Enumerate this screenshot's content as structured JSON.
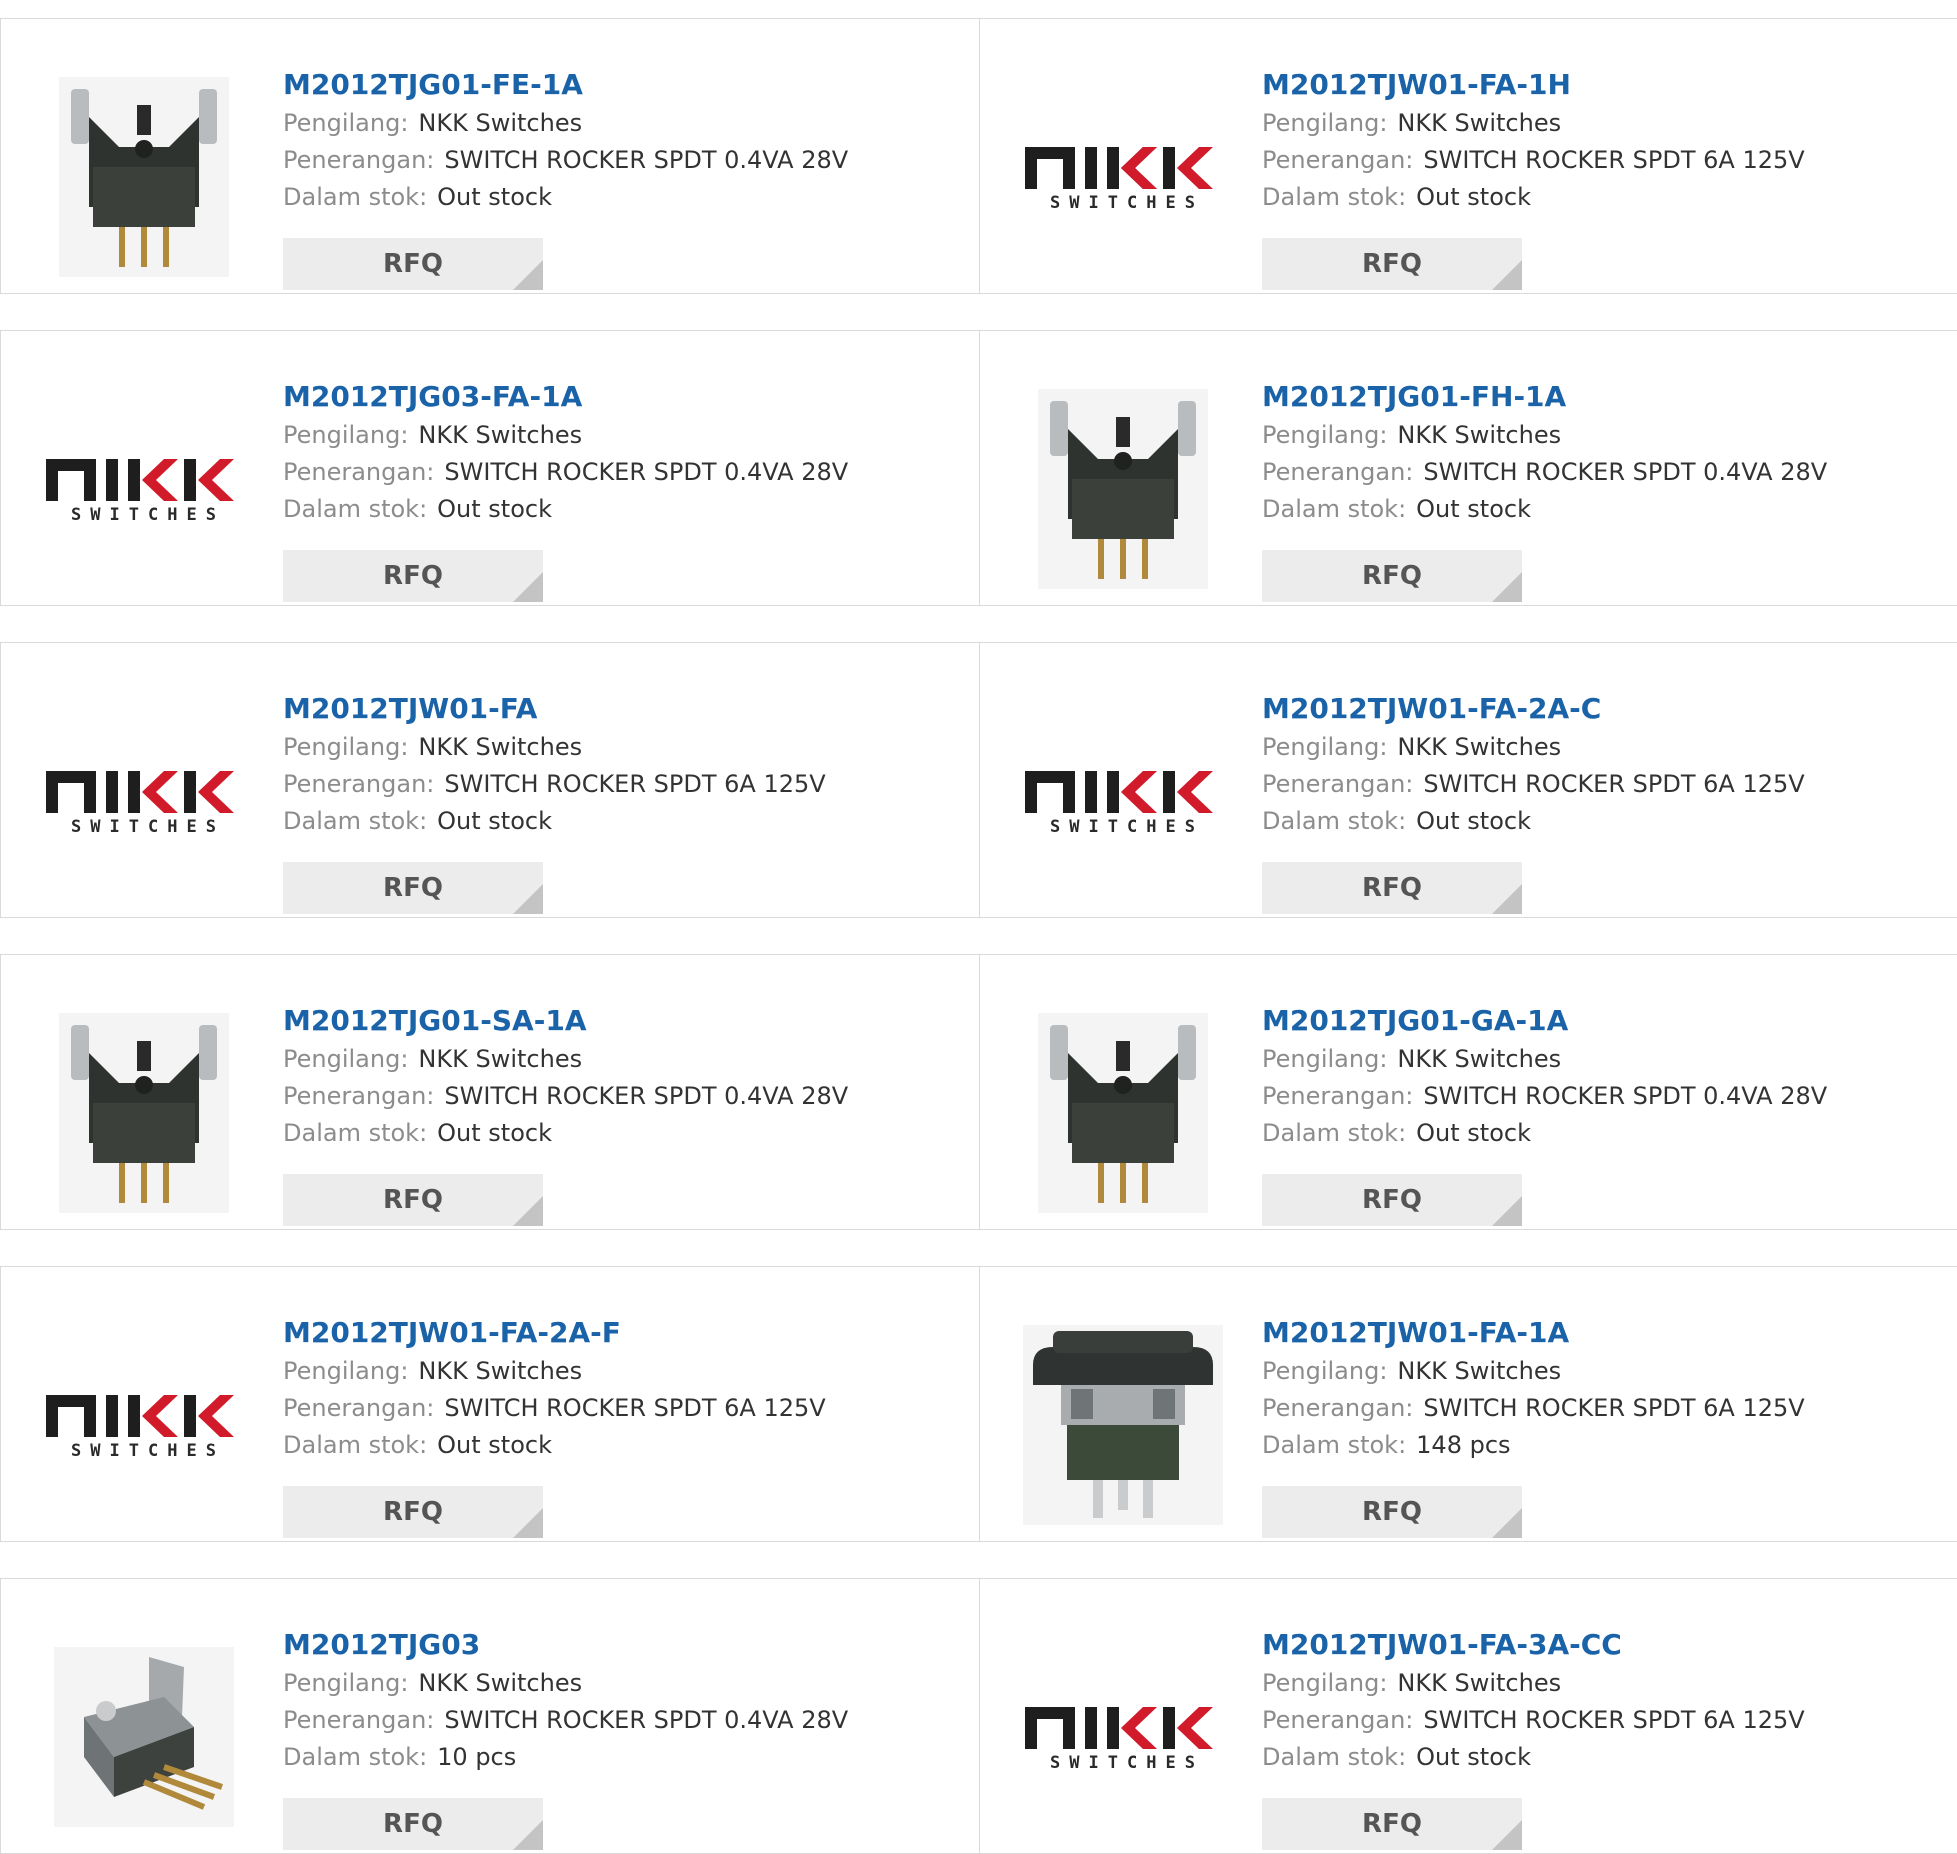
{
  "labels": {
    "manufacturer": "Pengilang:",
    "description": "Penerangan:",
    "stock": "Dalam stok:",
    "rfq": "RFQ"
  },
  "logo": {
    "subtitle": "SWITCHES"
  },
  "products": [
    {
      "part": "M2012TJG01-FE-1A",
      "manufacturer": "NKK Switches",
      "description": "SWITCH ROCKER SPDT 0.4VA 28V",
      "stock": "Out stock",
      "image": "toggle-switch-photo-icon"
    },
    {
      "part": "M2012TJW01-FA-1H",
      "manufacturer": "NKK Switches",
      "description": "SWITCH ROCKER SPDT 6A 125V",
      "stock": "Out stock",
      "image": "nkk-logo"
    },
    {
      "part": "M2012TJG03-FA-1A",
      "manufacturer": "NKK Switches",
      "description": "SWITCH ROCKER SPDT 0.4VA 28V",
      "stock": "Out stock",
      "image": "nkk-logo"
    },
    {
      "part": "M2012TJG01-FH-1A",
      "manufacturer": "NKK Switches",
      "description": "SWITCH ROCKER SPDT 0.4VA 28V",
      "stock": "Out stock",
      "image": "toggle-switch-photo-icon"
    },
    {
      "part": "M2012TJW01-FA",
      "manufacturer": "NKK Switches",
      "description": "SWITCH ROCKER SPDT 6A 125V",
      "stock": "Out stock",
      "image": "nkk-logo"
    },
    {
      "part": "M2012TJW01-FA-2A-C",
      "manufacturer": "NKK Switches",
      "description": "SWITCH ROCKER SPDT 6A 125V",
      "stock": "Out stock",
      "image": "nkk-logo"
    },
    {
      "part": "M2012TJG01-SA-1A",
      "manufacturer": "NKK Switches",
      "description": "SWITCH ROCKER SPDT 0.4VA 28V",
      "stock": "Out stock",
      "image": "toggle-switch-photo-icon"
    },
    {
      "part": "M2012TJG01-GA-1A",
      "manufacturer": "NKK Switches",
      "description": "SWITCH ROCKER SPDT 0.4VA 28V",
      "stock": "Out stock",
      "image": "toggle-switch-photo-icon"
    },
    {
      "part": "M2012TJW01-FA-2A-F",
      "manufacturer": "NKK Switches",
      "description": "SWITCH ROCKER SPDT 6A 125V",
      "stock": "Out stock",
      "image": "nkk-logo"
    },
    {
      "part": "M2012TJW01-FA-1A",
      "manufacturer": "NKK Switches",
      "description": "SWITCH ROCKER SPDT 6A 125V",
      "stock": "148 pcs",
      "image": "rocker-switch-photo-icon"
    },
    {
      "part": "M2012TJG03",
      "manufacturer": "NKK Switches",
      "description": "SWITCH ROCKER SPDT 0.4VA 28V",
      "stock": "10 pcs",
      "image": "angled-switch-photo-icon"
    },
    {
      "part": "M2012TJW01-FA-3A-CC",
      "manufacturer": "NKK Switches",
      "description": "SWITCH ROCKER SPDT 6A 125V",
      "stock": "Out stock",
      "image": "nkk-logo"
    }
  ]
}
